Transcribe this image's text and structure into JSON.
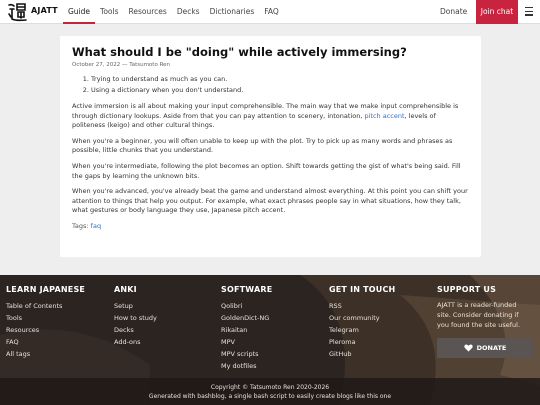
{
  "header": {
    "brand": "AJATT",
    "nav": [
      "Guide",
      "Tools",
      "Resources",
      "Decks",
      "Dictionaries",
      "FAQ"
    ],
    "donate": "Donate",
    "join": "Join chat"
  },
  "article": {
    "title": "What should I be \"doing\" while actively immersing?",
    "meta": "October 27, 2022 — Tatsumoto Ren",
    "list": [
      "Trying to understand as much as you can.",
      "Using a dictionary when you don't understand."
    ],
    "p1_before": "Active immersion is all about making your input comprehensible. The main way that we make input comprehensible is through dictionary lookups. Aside from that you can pay attention to scenery, intonation, ",
    "p1_link": "pitch accent",
    "p1_after": ", levels of politeness (keigo) and other cultural things.",
    "p2": "When you're a beginner, you will often unable to keep up with the plot. Try to pick up as many words and phrases as possible, little chunks that you understand.",
    "p3": "When you're intermediate, following the plot becomes an option. Shift towards getting the gist of what's being said. Fill the gaps by learning the unknown bits.",
    "p4": "When you're advanced, you've already beat the game and understand almost everything. At this point you can shift your attention to things that help you output. For example, what exact phrases people say in what situations, how they talk, what gestures or body language they use, Japanese pitch accent.",
    "tags_label": "Tags:",
    "tag": "faq"
  },
  "footer": {
    "col1": {
      "title": "LEARN JAPANESE",
      "links": [
        "Table of Contents",
        "Tools",
        "Resources",
        "FAQ",
        "All tags"
      ]
    },
    "col2": {
      "title": "ANKI",
      "links": [
        "Setup",
        "How to study",
        "Decks",
        "Add-ons"
      ]
    },
    "col3": {
      "title": "SOFTWARE",
      "links": [
        "Qolibri",
        "GoldenDict-NG",
        "Rikaitan",
        "MPV",
        "MPV scripts",
        "My dotfiles"
      ]
    },
    "col4": {
      "title": "GET IN TOUCH",
      "links": [
        "RSS",
        "Our community",
        "Telegram",
        "Pleroma",
        "GitHub"
      ]
    },
    "col5": {
      "title": "SUPPORT US",
      "text": "AJATT is a reader-funded site. Consider donating if you found the site useful.",
      "button": "DONATE"
    },
    "copyright": "Copyright © Tatsumoto Ren 2020-2026",
    "generated": "Generated with bashblog, a single bash script to easily create blogs like this one"
  },
  "colors": {
    "accent": "#c9243f",
    "link": "#2f6fc5",
    "footer_bg": "#2c2421"
  },
  "icons": [
    "logo-kanji-icon",
    "menu-icon",
    "heart-icon"
  ]
}
